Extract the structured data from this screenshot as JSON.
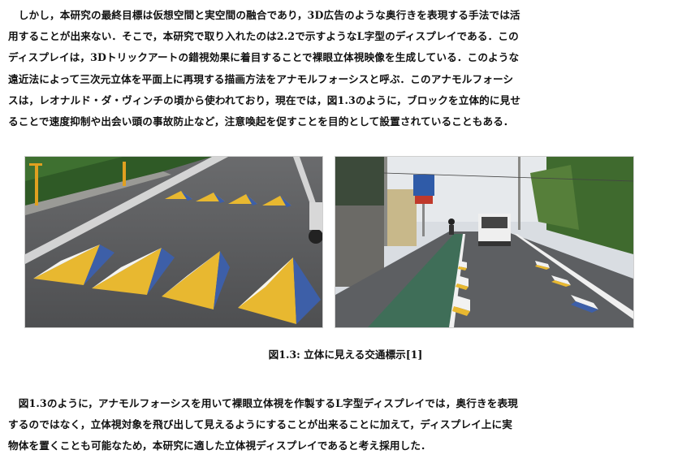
{
  "paragraph1": [
    "　しかし，本研究の最終目標は仮想空間と実空間の融合であり，3D広告のような奥行きを表現する手法では活",
    "用することが出来ない．そこで，本研究で取り入れたのは2.2で示すようなL字型のディスプレイである．この",
    "ディスプレイは，3Dトリックアートの錯視効果に着目することで裸眼立体視映像を生成している．このような",
    "遠近法によって三次元立体を平面上に再現する描画方法をアナモルフォーシスと呼ぶ．このアナモルフォーシ",
    "スは，レオナルド・ダ・ヴィンチの頃から使われており，現在では，図1.3のように，ブロックを立体的に見せ",
    "ることで速度抑制や出会い頭の事故防止など，注意喚起を促すことを目的として設置されていることもある．"
  ],
  "figure": {
    "caption": "図1.3: 立体に見える交通標示[1]",
    "left_image": "road-pyramid-markings-photo",
    "right_image": "street-bike-lane-markings-photo"
  },
  "paragraph2": [
    "　図1.3のように，アナモルフォーシスを用いて裸眼立体視を作製するL字型ディスプレイでは，奥行きを表現",
    "するのではなく，立体視対象を飛び出して見えるようにすることが出来ることに加えて，ディスプレイ上に実",
    "物体を置くことも可能なため，本研究に適した立体視ディスプレイであると考え採用した．"
  ],
  "colors": {
    "marking_yellow": "#e8b830",
    "marking_blue": "#3d5fa8",
    "asphalt": "#5b5c5e"
  }
}
